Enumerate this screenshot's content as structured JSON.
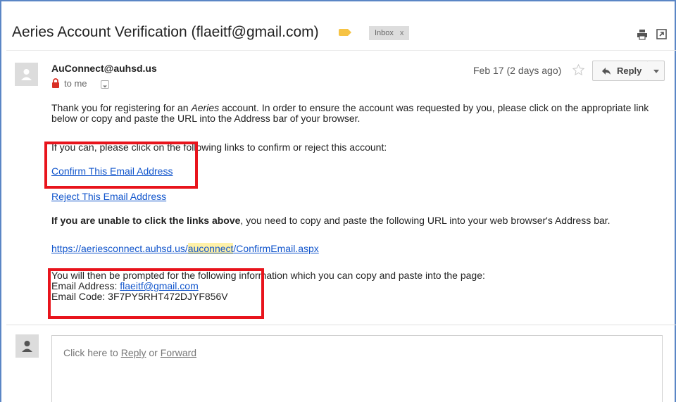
{
  "message": {
    "subject": "Aeries Account Verification (flaeitf@gmail.com)",
    "label": "Inbox",
    "label_close": "x",
    "sender": "AuConnect@auhsd.us",
    "recipient": "to me",
    "date": "Feb 17 (2 days ago)",
    "reply_label": "Reply"
  },
  "body": {
    "intro_before": "Thank you for registering for an ",
    "intro_brand": "Aeries",
    "intro_after": " account. In order to ensure the account was requested by you, please click on the appropriate link below or copy and paste the URL into the Address bar of your browser.",
    "links_intro": "If you can, please click on the following links to confirm or reject this account:",
    "confirm_link": "Confirm This Email Address",
    "reject_link": "Reject This Email Address",
    "unable_bold": "If you are unable to click the links above",
    "unable_rest": ", you need to copy and paste the following URL into your web browser's Address bar.",
    "url_before": "https://aeriesconnect.auhsd.us/",
    "url_highlight": "auconnect",
    "url_after": "/ConfirmEmail.aspx",
    "prompt_text": "You will then be prompted for the following information which you can copy and paste into the page:",
    "email_label": "Email Address: ",
    "email_value": "flaeitf@gmail.com",
    "code_label": "Email Code: ",
    "code_value": "3F7PY5RHT472DJYF856V"
  },
  "reply_area": {
    "prefix": "Click here to ",
    "reply": "Reply",
    "or": " or ",
    "forward": "Forward"
  },
  "colors": {
    "annotation": "#e8141c",
    "link": "#1155cc",
    "label_tag": "#f6c344",
    "highlight": "#fff1a8"
  }
}
